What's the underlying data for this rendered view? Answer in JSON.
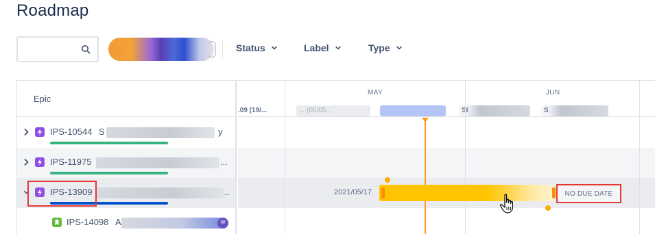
{
  "page": {
    "title": "Roadmap"
  },
  "search": {
    "value": "",
    "placeholder": ""
  },
  "filters": [
    {
      "label": "Status"
    },
    {
      "label": "Label"
    },
    {
      "label": "Type"
    }
  ],
  "table": {
    "column_header": "Epic",
    "rows": [
      {
        "key": "IPS-10544",
        "summary_fragment": "S",
        "summary_tail": "y",
        "progress_color": "#36b37e",
        "expanded": false
      },
      {
        "key": "IPS-11975",
        "summary_tail": "...",
        "progress_color": "#36b37e",
        "expanded": false
      },
      {
        "key": "IPS-13909",
        "summary_tail": "..",
        "progress_color": "#0052cc",
        "expanded": true
      },
      {
        "key": "IPS-14098",
        "summary_fragment": "A",
        "avatar_initial": "W"
      }
    ]
  },
  "timeline": {
    "months": [
      "MAY",
      "JUN"
    ],
    "sprints": [
      ".09 (19/...",
      "... (05/05...",
      "",
      "SI",
      "S"
    ],
    "bar": {
      "start_label": "2021/05/17",
      "end_label": "NO DUE DATE"
    },
    "colors": {
      "today_line": "#ff991f",
      "bar": "#ffc400",
      "highlight": "#e53935"
    }
  }
}
